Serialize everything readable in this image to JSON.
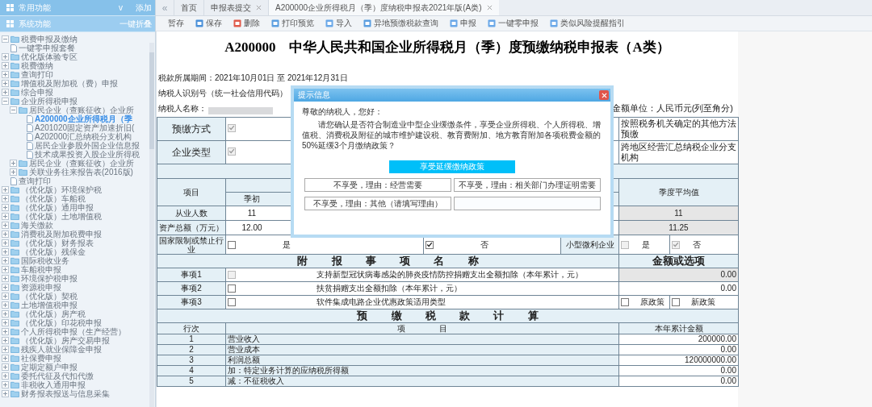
{
  "sidebar": {
    "panels": [
      {
        "label": "常用功能",
        "caret": "v",
        "action": "添加"
      },
      {
        "label": "系统功能",
        "action": "一键折叠"
      }
    ],
    "tree": [
      {
        "label": "税费申报及缴纳",
        "kind": "folder",
        "expanded": true,
        "selected": false
      },
      {
        "label": "一键零申报套餐",
        "kind": "doc",
        "selected": false
      },
      {
        "label": "优化版体验专区",
        "kind": "folder",
        "expanded": false,
        "selected": false
      },
      {
        "label": "税费缴纳",
        "kind": "folder",
        "expanded": false,
        "selected": false
      },
      {
        "label": "查询打印",
        "kind": "folder",
        "expanded": false,
        "selected": false
      },
      {
        "label": "增值税及附加税（费）申报",
        "kind": "folder",
        "expanded": false,
        "selected": false
      },
      {
        "label": "综合申报",
        "kind": "folder",
        "expanded": false,
        "selected": false
      },
      {
        "label": "企业所得税申报",
        "kind": "folder",
        "expanded": true,
        "selected": false,
        "children": [
          {
            "label": "居民企业（查账征收）企业所",
            "kind": "folder",
            "expanded": true,
            "selected": false,
            "children": [
              {
                "label": "A200000企业所得税月（季",
                "kind": "doc",
                "selected": true
              },
              {
                "label": "A201020固定资产加速折旧(",
                "kind": "doc",
                "selected": false
              },
              {
                "label": "A202000汇总纳税分支机构",
                "kind": "doc",
                "selected": false
              },
              {
                "label": "居民企业参股外国企业信息报",
                "kind": "doc",
                "selected": false
              },
              {
                "label": "技术成果投资入股企业所得税",
                "kind": "doc",
                "selected": false
              }
            ]
          },
          {
            "label": "居民企业（查账征收）企业所",
            "kind": "folder",
            "expanded": false,
            "selected": false
          },
          {
            "label": "关联业务往来报告表(2016版)",
            "kind": "folder",
            "expanded": false,
            "selected": false
          }
        ]
      },
      {
        "label": "查询打印",
        "kind": "doc",
        "selected": false
      },
      {
        "label": "（优化版）环境保护税",
        "kind": "folder",
        "expanded": false,
        "selected": false
      },
      {
        "label": "（优化版）车船税",
        "kind": "folder",
        "expanded": false,
        "selected": false
      },
      {
        "label": "（优化版）通用申报",
        "kind": "folder",
        "expanded": false,
        "selected": false
      },
      {
        "label": "（优化版）土地增值税",
        "kind": "folder",
        "expanded": false,
        "selected": false
      },
      {
        "label": "海关缴款",
        "kind": "folder",
        "expanded": false,
        "selected": false
      },
      {
        "label": "消费税及附加税费申报",
        "kind": "folder",
        "expanded": false,
        "selected": false
      },
      {
        "label": "（优化版）财务报表",
        "kind": "folder",
        "expanded": false,
        "selected": false
      },
      {
        "label": "（优化版）残保金",
        "kind": "folder",
        "expanded": false,
        "selected": false
      },
      {
        "label": "国际税收业务",
        "kind": "folder",
        "expanded": false,
        "selected": false
      },
      {
        "label": "车船税申报",
        "kind": "folder",
        "expanded": false,
        "selected": false
      },
      {
        "label": "环境保护税申报",
        "kind": "folder",
        "expanded": false,
        "selected": false
      },
      {
        "label": "资源税申报",
        "kind": "folder",
        "expanded": false,
        "selected": false
      },
      {
        "label": "（优化版）契税",
        "kind": "folder",
        "expanded": false,
        "selected": false
      },
      {
        "label": "土地增值税申报",
        "kind": "folder",
        "expanded": false,
        "selected": false
      },
      {
        "label": "（优化版）房产税",
        "kind": "folder",
        "expanded": false,
        "selected": false
      },
      {
        "label": "（优化版）印花税申报",
        "kind": "folder",
        "expanded": false,
        "selected": false
      },
      {
        "label": "个人所得税申报（生产经营）",
        "kind": "folder",
        "expanded": false,
        "selected": false
      },
      {
        "label": "（优化版）房产交易申报",
        "kind": "folder",
        "expanded": false,
        "selected": false
      },
      {
        "label": "残疾人就业保障金申报",
        "kind": "folder",
        "expanded": false,
        "selected": false
      },
      {
        "label": "社保费申报",
        "kind": "folder",
        "expanded": false,
        "selected": false
      },
      {
        "label": "定期定额户申报",
        "kind": "folder",
        "expanded": false,
        "selected": false
      },
      {
        "label": "委托代征及代扣代缴",
        "kind": "folder",
        "expanded": false,
        "selected": false
      },
      {
        "label": "非税收入通用申报",
        "kind": "folder",
        "expanded": false,
        "selected": false
      },
      {
        "label": "财务报表报送与信息采集",
        "kind": "folder",
        "expanded": false,
        "selected": false
      }
    ]
  },
  "tab_scroll": "«",
  "tabs": [
    {
      "label": "首页",
      "closable": false,
      "selected": false
    },
    {
      "label": "申报表提交",
      "closable": true,
      "selected": false
    },
    {
      "label": "A200000企业所得税月（季）度纳税申报表2021年版(A类)",
      "closable": true,
      "selected": true
    }
  ],
  "toolbar": [
    {
      "label": "暂存",
      "kind": "plain"
    },
    {
      "label": "保存",
      "kind": "save"
    },
    {
      "label": "删除",
      "kind": "delete"
    },
    {
      "label": "打印预览",
      "kind": "doc"
    },
    {
      "label": "导入",
      "kind": "edit"
    },
    {
      "label": "异地预缴税款查询",
      "kind": "doc"
    },
    {
      "label": "申报",
      "kind": "edit"
    },
    {
      "label": "一键零申报",
      "kind": "edit"
    },
    {
      "label": "类似风险提醒指引",
      "kind": "edit"
    }
  ],
  "form": {
    "title": "A200000　中华人民共和国企业所得税月（季）度预缴纳税申报表（A类）",
    "period": "税款所属期间：2021年10月01日 至 2021年12月31日",
    "taxpayer_id_label": "纳税人识别号（统一社会信用代码）",
    "taxpayer_name_label": "纳税人名称：",
    "unit": "金额单位：人民币元(列至角分)",
    "prepay_rows": [
      {
        "label": "预缴方式",
        "checked": true,
        "disabled": true,
        "option": "按照税务机关确定的其他方法预缴"
      },
      {
        "label": "企业类型",
        "checked": true,
        "disabled": true,
        "option": "跨地区经营汇总纳税企业分支机构"
      }
    ],
    "profile": {
      "item_header": "项目",
      "sub_header": "季初",
      "avg_header": "季度平均值",
      "rows": [
        {
          "label": "从业人数",
          "q_start": "11",
          "average": "11"
        },
        {
          "label": "资产总额（万元）",
          "q_start": "12.00",
          "average": "11.25"
        }
      ]
    },
    "restricted": {
      "label": "国家限制或禁止行业",
      "options": [
        {
          "label": "是",
          "checked": false,
          "disabled": false
        },
        {
          "label": "否",
          "checked": true,
          "disabled": false
        }
      ],
      "small_label": "小型微利企业",
      "small_options": [
        {
          "label": "是",
          "checked": false,
          "disabled": true
        },
        {
          "label": "否",
          "checked": true,
          "disabled": true
        }
      ]
    },
    "attachments": {
      "title": "附 报 事 项 名 称",
      "value_title": "金额或选项",
      "rows": [
        {
          "label": "事项1",
          "checked": false,
          "disabled": true,
          "name": "支持新型冠状病毒感染的肺炎疫情防控捐赠支出全额扣除（本年累计，元）",
          "kind": "amount",
          "value": "0.00",
          "readonly": true
        },
        {
          "label": "事项2",
          "checked": false,
          "disabled": false,
          "name": "扶贫捐赠支出全额扣除（本年累计，元）",
          "kind": "amount",
          "value": "0.00",
          "readonly": false
        },
        {
          "label": "事项3",
          "checked": false,
          "disabled": false,
          "name": "软件集成电路企业优惠政策适用类型",
          "kind": "choice",
          "options": [
            {
              "label": "原政策",
              "checked": false
            },
            {
              "label": "新政策",
              "checked": false
            }
          ]
        }
      ]
    },
    "calc": {
      "title": "预 缴 税 款 计 算",
      "columns": [
        "行次",
        "项 目",
        "本年累计金额"
      ],
      "rows": [
        {
          "line": "1",
          "item": "营业收入",
          "amount": "200000.00"
        },
        {
          "line": "2",
          "item": "营业成本",
          "amount": "0.00"
        },
        {
          "line": "3",
          "item": "利润总额",
          "amount": "120000000.00"
        },
        {
          "line": "4",
          "item": "加：特定业务计算的应纳税所得额",
          "amount": "0.00"
        },
        {
          "line": "5",
          "item": "减：不征税收入",
          "amount": "0.00"
        }
      ]
    }
  },
  "dialog": {
    "title": "提示信息",
    "greeting": "尊敬的纳税人，您好：",
    "message": "请您确认是否符合制造业中型企业缓缴条件，享受企业所得税、个人所得税、增值税、消费税及附征的城市维护建设税、教育费附加、地方教育附加各项税费金额的50%延缓3个月缴纳政策？",
    "primary": "享受延缓缴纳政策",
    "choices": [
      "不享受，理由：经营需要",
      "不享受，理由：相关部门办理证明需要",
      "不享受，理由：其他（请填写理由）"
    ]
  }
}
